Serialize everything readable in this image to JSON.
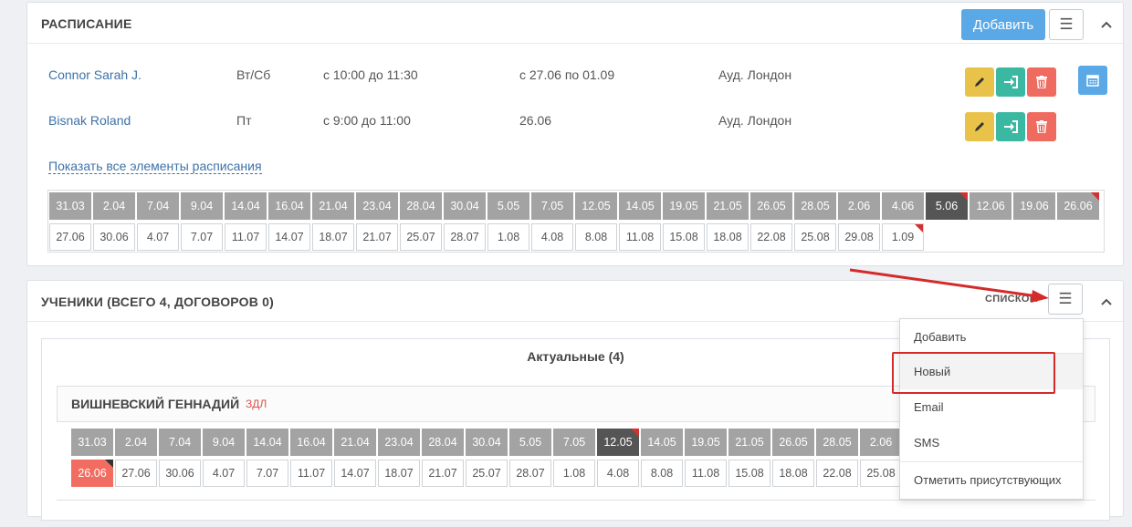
{
  "schedule": {
    "title": "РАСПИСАНИЕ",
    "add_label": "Добавить",
    "rows": [
      {
        "name": "Connor Sarah J.",
        "days": "Вт/Сб",
        "time": "с 10:00 до 11:30",
        "period": "с 27.06 по 01.09",
        "room": "Ауд. Лондон"
      },
      {
        "name": "Bisnak Roland",
        "days": "Пт",
        "time": "с 9:00 до 11:00",
        "period": "26.06",
        "room": "Ауд. Лондон"
      }
    ],
    "show_all": "Показать все элементы расписания",
    "dates_row1": [
      "31.03",
      "2.04",
      "7.04",
      "9.04",
      "14.04",
      "16.04",
      "21.04",
      "23.04",
      "28.04",
      "30.04",
      "5.05",
      "7.05",
      "12.05",
      "14.05",
      "19.05",
      "21.05",
      "26.05",
      "28.05",
      "2.06",
      "4.06",
      "5.06",
      "12.06",
      "19.06",
      "26.06"
    ],
    "dates_row2": [
      "27.06",
      "30.06",
      "4.07",
      "7.07",
      "11.07",
      "14.07",
      "18.07",
      "21.07",
      "25.07",
      "28.07",
      "1.08",
      "4.08",
      "8.08",
      "11.08",
      "15.08",
      "18.08",
      "22.08",
      "25.08",
      "29.08",
      "1.09"
    ],
    "current_date": "5.06"
  },
  "students": {
    "title": "УЧЕНИКИ (ВСЕГО 4, ДОГОВОРОВ 0)",
    "view_label": "СПИСКОМ",
    "group_title": "Актуальные (4)",
    "student_name": "ВИШНЕВСКИЙ ГЕННАДИЙ",
    "student_tag": "ЗДЛ",
    "dates_row1": [
      "31.03",
      "2.04",
      "7.04",
      "9.04",
      "14.04",
      "16.04",
      "21.04",
      "23.04",
      "28.04",
      "30.04",
      "5.05",
      "7.05",
      "12.05",
      "14.05",
      "19.05",
      "21.05",
      "26.05",
      "28.05",
      "2.06"
    ],
    "dates_row2": [
      "26.06",
      "27.06",
      "30.06",
      "4.07",
      "7.07",
      "11.07",
      "14.07",
      "18.07",
      "21.07",
      "25.07",
      "28.07",
      "1.08",
      "4.08",
      "8.08",
      "11.08",
      "15.08",
      "18.08",
      "22.08",
      "25.08"
    ],
    "current_date": "12.05"
  },
  "menu": {
    "items": [
      "Добавить",
      "Новый",
      "Email",
      "SMS",
      "Отметить присутствующих"
    ],
    "highlighted": "Новый"
  },
  "colors": {
    "accent": "#5aa9e6",
    "edit": "#e9c24a",
    "go": "#3bb8a1",
    "delete": "#ef6b5f",
    "annotation": "#d42a2a"
  }
}
